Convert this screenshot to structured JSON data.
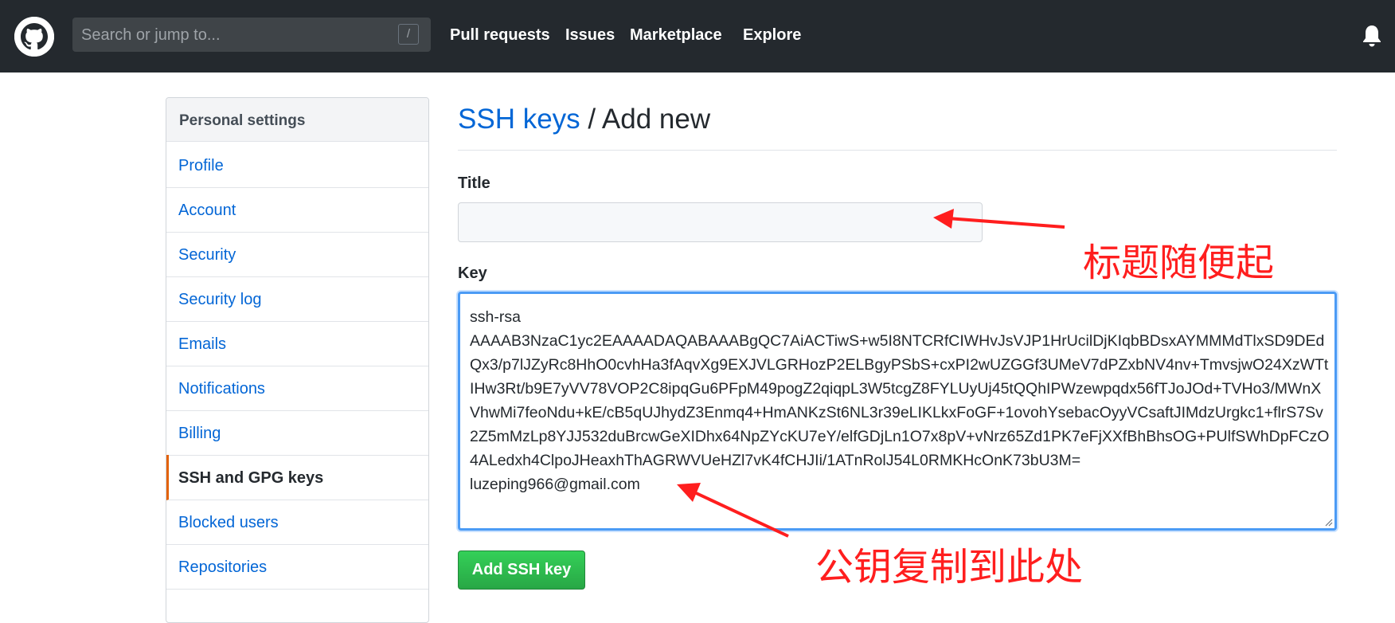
{
  "header": {
    "search_placeholder": "Search or jump to...",
    "search_shortcut": "/",
    "nav": [
      "Pull requests",
      "Issues",
      "Marketplace",
      "Explore"
    ]
  },
  "sidebar": {
    "heading": "Personal settings",
    "items": [
      {
        "label": "Profile"
      },
      {
        "label": "Account"
      },
      {
        "label": "Security"
      },
      {
        "label": "Security log"
      },
      {
        "label": "Emails"
      },
      {
        "label": "Notifications"
      },
      {
        "label": "Billing"
      },
      {
        "label": "SSH and GPG keys",
        "active": true
      },
      {
        "label": "Blocked users"
      },
      {
        "label": "Repositories"
      }
    ]
  },
  "main": {
    "breadcrumb_link": "SSH keys",
    "breadcrumb_sep": " / ",
    "breadcrumb_current": "Add new",
    "title_label": "Title",
    "title_value": "",
    "key_label": "Key",
    "key_value": "ssh-rsa\nAAAAB3NzaC1yc2EAAAADAQABAAABgQC7AiACTiwS+w5I8NTCRfCIWHvJsVJP1HrUcilDjKIqbBDsxAYMMMdTlxSD9DEdQx3/p7lJZyRc8HhO0cvhHa3fAqvXg9EXJVLGRHozP2ELBgyPSbS+cxPI2wUZGGf3UMeV7dPZxbNV4nv+TmvsjwO24XzWTtIHw3Rt/b9E7yVV78VOP2C8ipqGu6PFpM49pogZ2qiqpL3W5tcgZ8FYLUyUj45tQQhIPWzewpqdx56fTJoJOd+TVHo3/MWnXVhwMi7feoNdu+kE/cB5qUJhydZ3Enmq4+HmANKzSt6NL3r39eLIKLkxFoGF+1ovohYsebacOyyVCsaftJIMdzUrgkc1+flrS7Sv2Z5mMzLp8YJJ532duBrcwGeXIDhx64NpZYcKU7eY/elfGDjLn1O7x8pV+vNrz65Zd1PK7eFjXXfBhBhsOG+PUlfSWhDpFCzO4ALedxh4ClpoJHeaxhThAGRWVUeHZl7vK4fCHJIi/1ATnRolJ54L0RMKHcOnK73bU3M=\nluzeping966@gmail.com",
    "submit_label": "Add SSH key"
  },
  "annotations": {
    "title_note": "标题随便起",
    "key_note": "公钥复制到此处",
    "color": "#ff1e1e"
  }
}
